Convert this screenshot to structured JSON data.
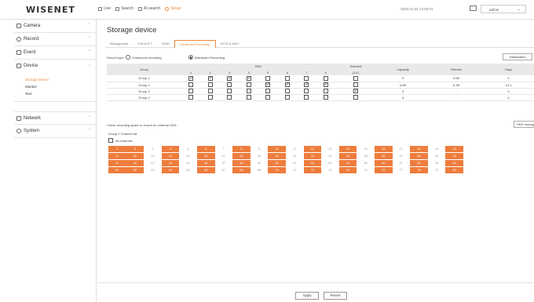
{
  "topbar": {
    "logo": "WISENET",
    "nav": [
      {
        "label": "Live",
        "active": false
      },
      {
        "label": "Search",
        "active": false
      },
      {
        "label": "AI search",
        "active": false
      },
      {
        "label": "Setup",
        "active": true
      }
    ],
    "datetime": "2020-11-24 12:00:01",
    "user": "admin"
  },
  "sidebar": {
    "sections": [
      {
        "label": "Camera",
        "icon": "camera-icon",
        "expanded": false
      },
      {
        "label": "Record",
        "icon": "record-icon",
        "expanded": false
      },
      {
        "label": "Event",
        "icon": "event-icon",
        "expanded": false
      },
      {
        "label": "Device",
        "icon": "device-icon",
        "expanded": true,
        "items": [
          "Storage device",
          "Monitor",
          "Text"
        ]
      },
      {
        "label": "Network",
        "icon": "network-icon",
        "expanded": false
      },
      {
        "label": "System",
        "icon": "system-icon",
        "expanded": false
      }
    ],
    "active_item": "Storage device"
  },
  "main": {
    "title": "Storage device",
    "tabs": [
      "Management",
      "S.M.A.R.T.",
      "RAID",
      "Distributed Recording",
      "iSCSI & NAS"
    ],
    "active_tab": "Distributed Recording",
    "record_type_label": "Record type",
    "record_types": [
      "Continuous recording",
      "Distributed Recording"
    ],
    "selected_record_type": "Distributed Recording",
    "init_button": "Initialization",
    "table": {
      "headers": {
        "group": "Group",
        "hdd": "HDD",
        "external": "External",
        "capacity": "Capacity",
        "remain": "Remain",
        "days": "Days"
      },
      "hdd_cols": [
        "1",
        "2",
        "3",
        "4",
        "5",
        "6",
        "7",
        "8"
      ],
      "ext_col": "(1/1)",
      "rows": [
        {
          "group": "Group 1",
          "hdd": [
            1,
            1,
            1,
            1,
            0,
            0,
            0,
            0
          ],
          "ext": 0,
          "capacity": "0",
          "remain": "0.0B",
          "days": "0"
        },
        {
          "group": "Group 2",
          "hdd": [
            0,
            0,
            0,
            0,
            1,
            1,
            1,
            1
          ],
          "ext": 0,
          "capacity": "0.0B",
          "remain": "0.7B",
          "days": "13.1"
        },
        {
          "group": "Group 3",
          "hdd": [
            0,
            0,
            0,
            0,
            0,
            0,
            0,
            0
          ],
          "ext": 1,
          "capacity": "0",
          "remain": "-",
          "days": "0"
        },
        {
          "group": "Group 4",
          "hdd": [
            0,
            0,
            0,
            0,
            0,
            0,
            0,
            0
          ],
          "ext": 0,
          "capacity": "0",
          "remain": "-",
          "days": "0"
        }
      ]
    },
    "note": "Check recording space to record on external HDD.",
    "hdd_button": "HDD management",
    "group_title": "Group 1 Channel list",
    "all_channels": "All channels",
    "channels_pattern": [
      1,
      1,
      0,
      1,
      0,
      1,
      0,
      1,
      0,
      1,
      0,
      1,
      0,
      1,
      0,
      1,
      0,
      1,
      0,
      1
    ],
    "channel_rows": 4,
    "apply": "Apply",
    "revert": "Revert"
  },
  "colors": {
    "accent": "#ee7d3d",
    "header_bg": "#e9e9e9"
  }
}
